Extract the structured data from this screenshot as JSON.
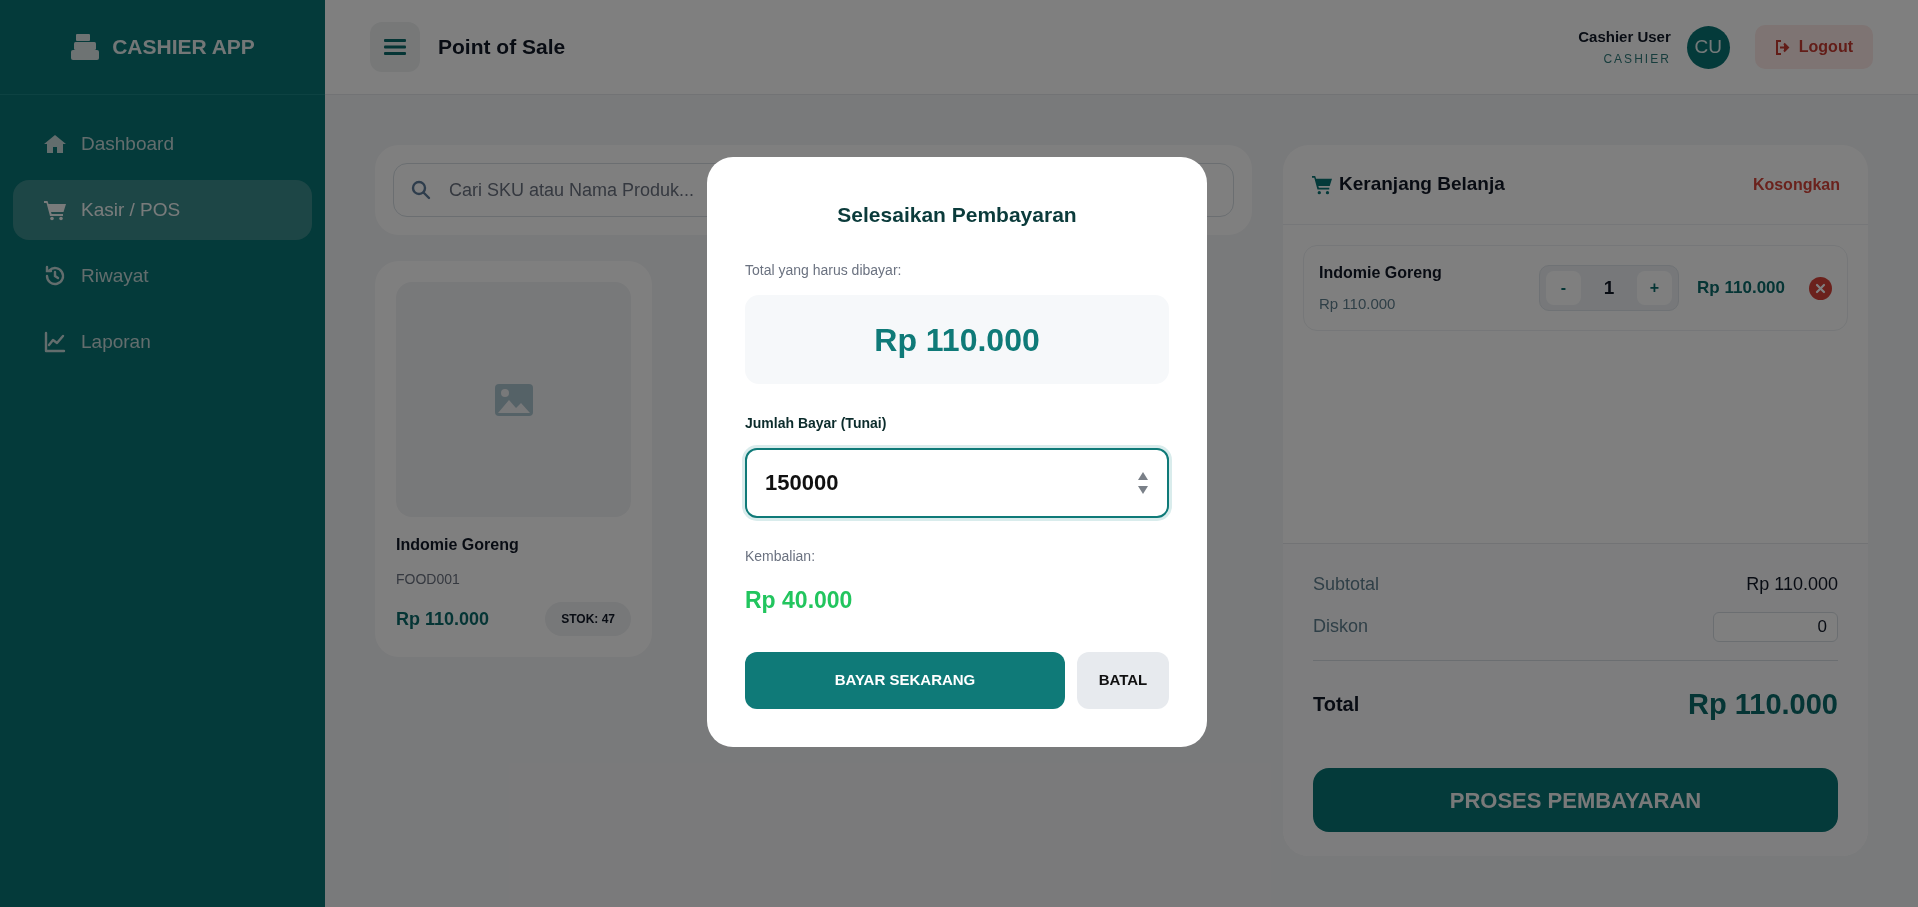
{
  "sidebar": {
    "brand": "CASHIER APP",
    "items": [
      {
        "label": "Dashboard",
        "selected": false
      },
      {
        "label": "Kasir / POS",
        "selected": true
      },
      {
        "label": "Riwayat",
        "selected": false
      },
      {
        "label": "Laporan",
        "selected": false
      }
    ]
  },
  "header": {
    "title": "Point of Sale",
    "user_name": "Cashier User",
    "user_role": "CASHIER",
    "avatar": "CU",
    "logout": "Logout"
  },
  "search": {
    "placeholder": "Cari SKU atau Nama Produk..."
  },
  "products": [
    {
      "name": "Indomie Goreng",
      "sku": "FOOD001",
      "price": "Rp 110.000",
      "stock": "STOK: 47"
    }
  ],
  "cart": {
    "title": "Keranjang Belanja",
    "clear": "Kosongkan",
    "items": [
      {
        "name": "Indomie Goreng",
        "unit_price": "Rp 110.000",
        "minus": "-",
        "quantity": "1",
        "plus": "+",
        "total": "Rp 110.000"
      }
    ],
    "subtotal_label": "Subtotal",
    "subtotal": "Rp 110.000",
    "discount_label": "Diskon",
    "discount": "0",
    "total_label": "Total",
    "total": "Rp 110.000",
    "checkout": "PROSES PEMBAYARAN"
  },
  "modal": {
    "title": "Selesaikan Pembayaran",
    "total_label": "Total yang harus dibayar:",
    "total": "Rp 110.000",
    "paid_label": "Jumlah Bayar (Tunai)",
    "paid": "150000",
    "change_label": "Kembalian:",
    "change": "Rp 40.000",
    "pay_button": "BAYAR SEKARANG",
    "cancel_button": "BATAL"
  }
}
